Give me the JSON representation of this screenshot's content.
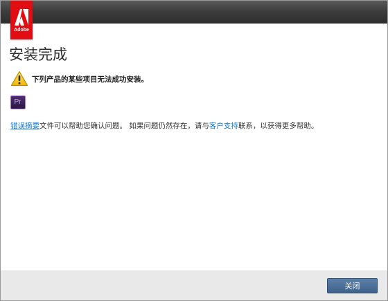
{
  "brand": {
    "logo_text": "Adobe",
    "logo_color": "#e20c13"
  },
  "page": {
    "title": "安装完成"
  },
  "warning": {
    "icon": "warning-icon",
    "text": "下列产品的某些项目无法成功安装。"
  },
  "products": [
    {
      "icon_text": "Pr",
      "icon": "premiere-pro-icon"
    }
  ],
  "info": {
    "link_error_summary": "错误摘要",
    "text_1": "文件可以帮助您确认问题。 如果问题仍然存在，请与",
    "link_customer_support": "客户支持",
    "text_2": "联系，以获得更多帮助。"
  },
  "footer": {
    "close_label": "关闭",
    "button_color": "#4a6d95"
  },
  "colors": {
    "link": "#1479d1",
    "titlebar": "#3d3d3d"
  }
}
